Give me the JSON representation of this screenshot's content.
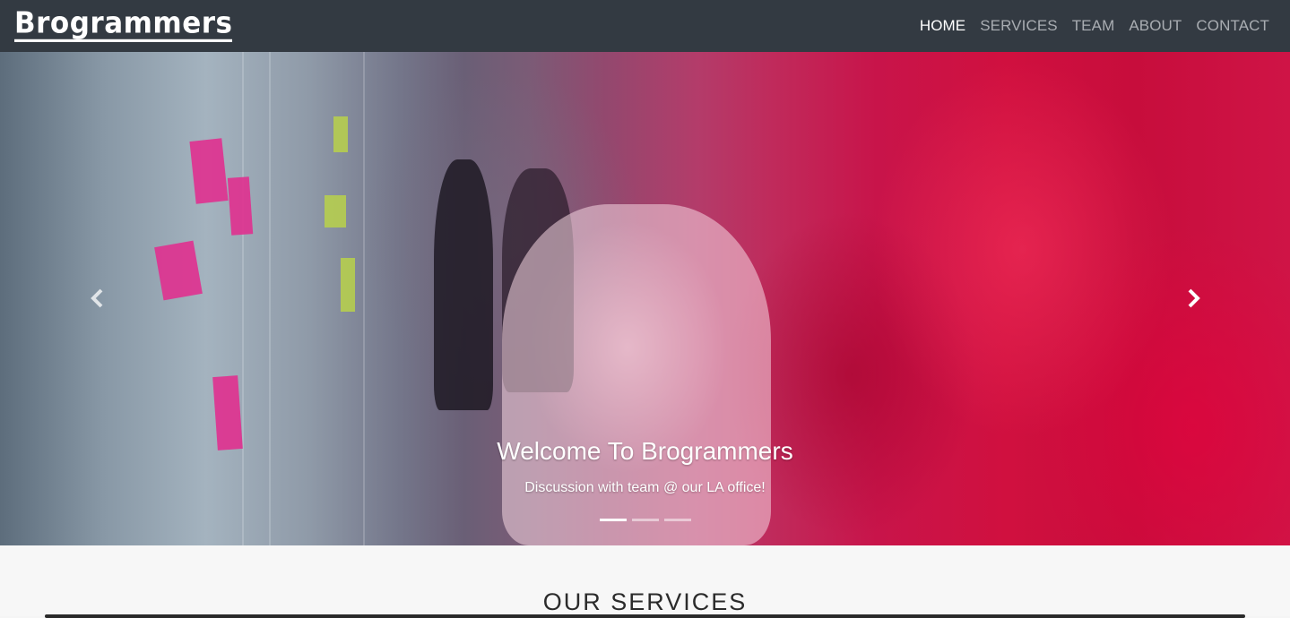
{
  "navbar": {
    "brand": "Brogrammers",
    "links": [
      "HOME",
      "SERVICES",
      "TEAM",
      "ABOUT",
      "CONTACT"
    ],
    "active_link": "HOME",
    "colors": {
      "background": "#333a42",
      "active": "#ffffff",
      "inactive": "#a9adb2"
    }
  },
  "carousel": {
    "caption_title": "Welcome To Brogrammers",
    "caption_subtitle": "Discussion with team @ our LA office!",
    "slide_count": 3,
    "active_slide": 1,
    "prev_icon": "chevron-left-icon",
    "next_icon": "chevron-right-icon"
  },
  "services": {
    "title": "OUR SERVICES"
  }
}
